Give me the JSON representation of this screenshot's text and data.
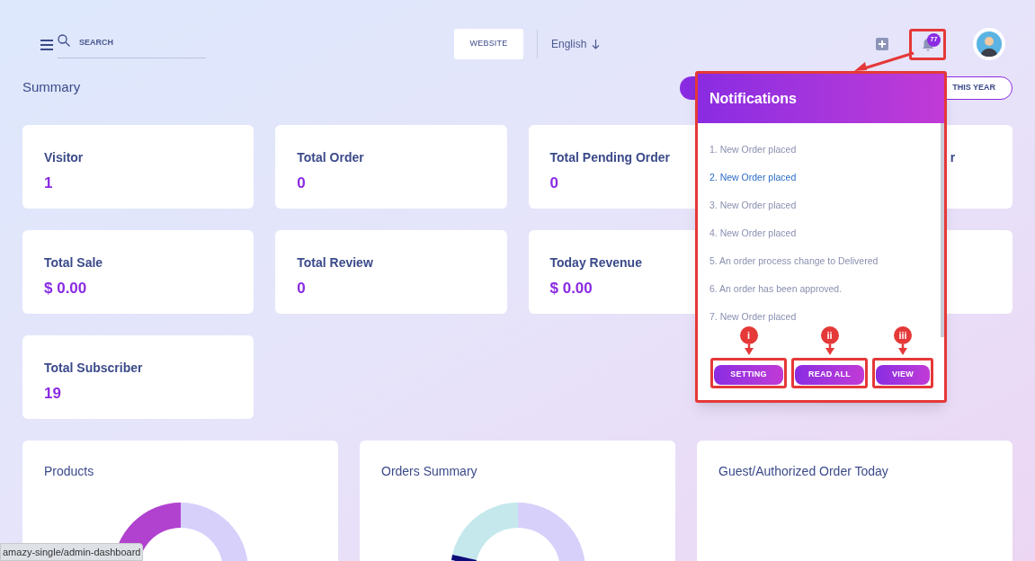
{
  "header": {
    "search": {
      "placeholder": "SEARCH"
    },
    "website_button": "WEBSITE",
    "language": "English",
    "notification_count": "77"
  },
  "summary": {
    "title": "Summary",
    "filters": [
      {
        "label": "THIS YEAR",
        "selected": false
      }
    ]
  },
  "stat_cards": [
    {
      "kind": "stat",
      "title": "Visitor",
      "value": "1"
    },
    {
      "kind": "stat",
      "title": "Total Order",
      "value": "0"
    },
    {
      "kind": "stat",
      "title": "Total Pending Order",
      "value": "0"
    },
    {
      "kind": "stat",
      "title": "r"
    },
    {
      "kind": "stat",
      "title": "Total Sale",
      "value": "$ 0.00"
    },
    {
      "kind": "stat",
      "title": "Total Review",
      "value": "0"
    },
    {
      "kind": "stat",
      "title": "Today Revenue",
      "value": "$ 0.00"
    },
    {
      "kind": "blank"
    },
    {
      "kind": "stat",
      "title": "Total Subscriber",
      "value": "19"
    }
  ],
  "chart_cards": [
    {
      "title": "Products",
      "kind": "products"
    },
    {
      "title": "Orders Summary",
      "kind": "orders"
    },
    {
      "title": "Guest/Authorized Order Today",
      "kind": "empty"
    }
  ],
  "notifications": {
    "title": "Notifications",
    "items": [
      {
        "text": "1. New Order placed",
        "highlighted": false
      },
      {
        "text": "2. New Order placed",
        "highlighted": true
      },
      {
        "text": "3. New Order placed",
        "highlighted": false
      },
      {
        "text": "4. New Order placed",
        "highlighted": false
      },
      {
        "text": "5. An order process change to Delivered",
        "highlighted": false
      },
      {
        "text": "6. An order has been approved.",
        "highlighted": false
      },
      {
        "text": "7. New Order placed",
        "highlighted": false
      }
    ],
    "buttons": [
      {
        "label": "SETTING",
        "marker": "i"
      },
      {
        "label": "READ ALL",
        "marker": "ii"
      },
      {
        "label": "VIEW",
        "marker": "iii"
      }
    ]
  },
  "status_bar": {
    "url": "amazy-single/admin-dashboard"
  }
}
